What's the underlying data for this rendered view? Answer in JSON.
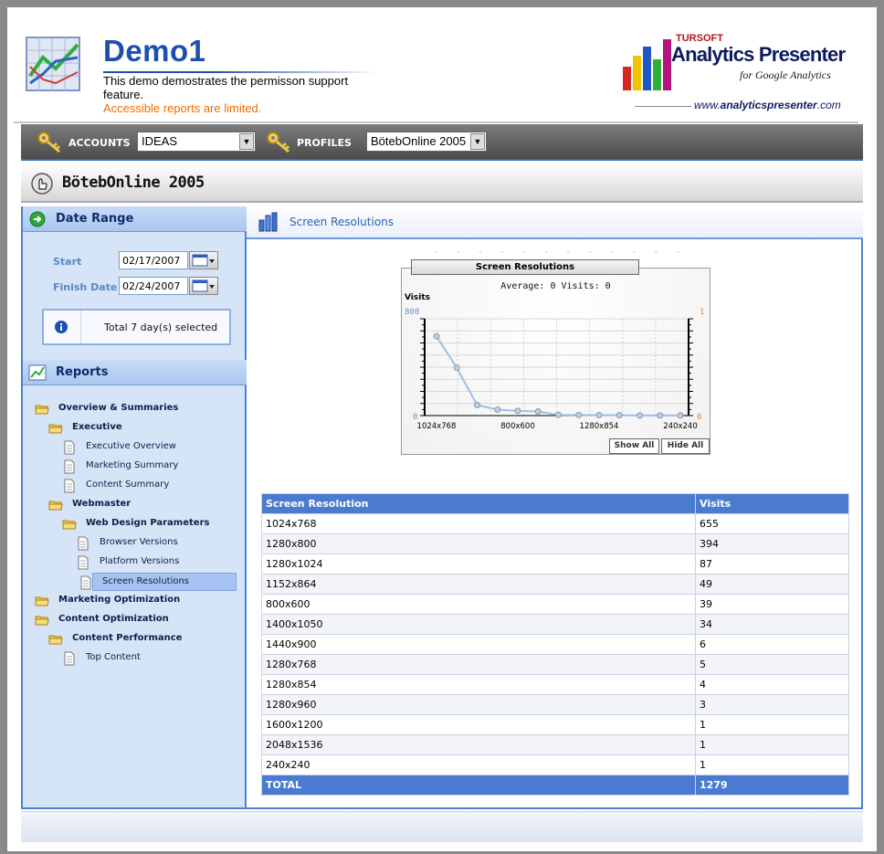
{
  "header": {
    "title": "Demo1",
    "description": "This demo demostrates the permisson support feature.",
    "note": "Accessible reports are limited.",
    "brand": {
      "company": "TURSOFT",
      "product": "Analytics Presenter",
      "tagline": "for Google Analytics",
      "url_prefix": "www.",
      "url_main": "analyticspresenter",
      "url_suffix": ".com"
    }
  },
  "toolbar": {
    "accounts_label": "ACCOUNTS",
    "accounts_value": "IDEAS",
    "profiles_label": "PROFILES",
    "profiles_value": "BötebOnline 2005"
  },
  "profile_title": "BötebOnline 2005",
  "date_range": {
    "heading": "Date Range",
    "start_label": "Start",
    "start_value": "02/17/2007",
    "finish_label": "Finish Date",
    "finish_value": "02/24/2007",
    "summary": "Total 7 day(s) selected"
  },
  "reports": {
    "heading": "Reports",
    "tree": [
      {
        "label": "Overview & Summaries",
        "type": "folder"
      },
      {
        "label": "Executive",
        "type": "folder"
      },
      {
        "label": "Executive Overview",
        "type": "page"
      },
      {
        "label": "Marketing Summary",
        "type": "page"
      },
      {
        "label": "Content Summary",
        "type": "page"
      },
      {
        "label": "Webmaster",
        "type": "folder"
      },
      {
        "label": "Web Design Parameters",
        "type": "folder"
      },
      {
        "label": "Browser Versions",
        "type": "page"
      },
      {
        "label": "Platform Versions",
        "type": "page"
      },
      {
        "label": "Screen Resolutions",
        "type": "page",
        "selected": true
      },
      {
        "label": "Marketing Optimization",
        "type": "folder"
      },
      {
        "label": "Content Optimization",
        "type": "folder"
      },
      {
        "label": "Content Performance",
        "type": "folder"
      },
      {
        "label": "Top Content",
        "type": "page"
      }
    ]
  },
  "main": {
    "heading": "Screen Resolutions",
    "chart_title": "Screen Resolutions",
    "chart_subtitle": "Average: 0 Visits: 0",
    "show_all": "Show All",
    "hide_all": "Hide All"
  },
  "chart_data": {
    "type": "line",
    "title": "Screen Resolutions",
    "subtitle": "Average: 0 Visits: 0",
    "ylabel": "Visits",
    "ylim": [
      0,
      800
    ],
    "y2lim": [
      0,
      1
    ],
    "y_ticks": [
      "800",
      "0"
    ],
    "y2_ticks": [
      "1",
      "0"
    ],
    "x_tick_labels": [
      "1024x768",
      "800x600",
      "1280x854",
      "240x240"
    ],
    "categories": [
      "1024x768",
      "1280x800",
      "1280x1024",
      "1152x864",
      "800x600",
      "1400x1050",
      "1440x900",
      "1280x768",
      "1280x854",
      "1280x960",
      "1600x1200",
      "2048x1536",
      "240x240"
    ],
    "values": [
      655,
      394,
      87,
      49,
      39,
      34,
      6,
      5,
      4,
      3,
      1,
      1,
      1
    ],
    "grid": true,
    "colors": {
      "line": "#9cc0e8",
      "marker": "#8899aa",
      "left_axis": "#6e8fc8",
      "right_axis": "#e08a3c"
    }
  },
  "table": {
    "headers": [
      "Screen Resolution",
      "Visits"
    ],
    "rows": [
      [
        "1024x768",
        "655"
      ],
      [
        "1280x800",
        "394"
      ],
      [
        "1280x1024",
        "87"
      ],
      [
        "1152x864",
        "49"
      ],
      [
        "800x600",
        "39"
      ],
      [
        "1400x1050",
        "34"
      ],
      [
        "1440x900",
        "6"
      ],
      [
        "1280x768",
        "5"
      ],
      [
        "1280x854",
        "4"
      ],
      [
        "1280x960",
        "3"
      ],
      [
        "1600x1200",
        "1"
      ],
      [
        "2048x1536",
        "1"
      ],
      [
        "240x240",
        "1"
      ]
    ],
    "total": [
      "TOTAL",
      "1279"
    ]
  }
}
